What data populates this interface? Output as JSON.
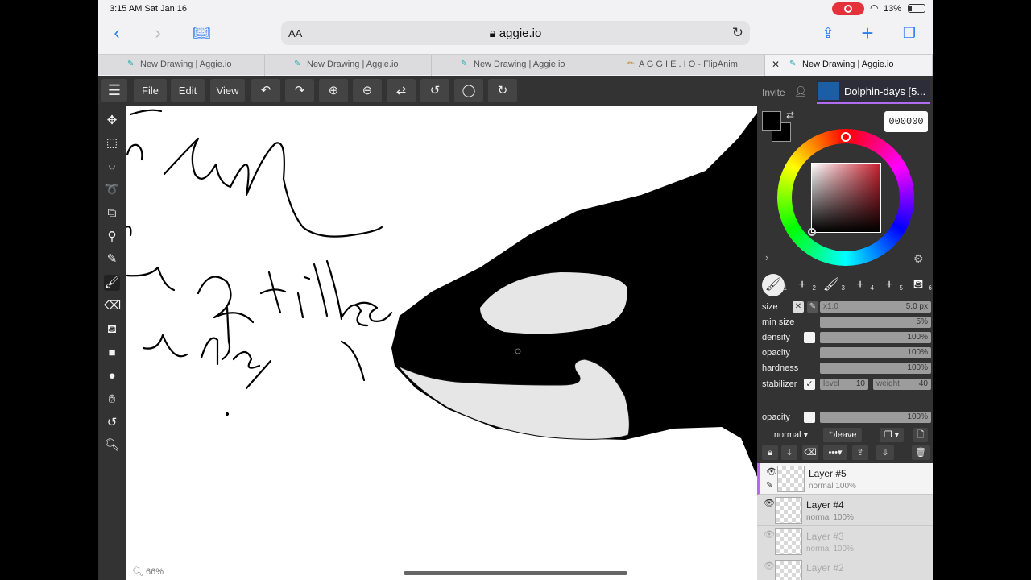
{
  "status": {
    "time": "3:15 AM  Sat Jan 16",
    "battery": "13%"
  },
  "browser": {
    "url": "aggie.io",
    "aa": "AA",
    "tabs": [
      {
        "label": "New Drawing | Aggie.io"
      },
      {
        "label": "New Drawing | Aggie.io"
      },
      {
        "label": "New Drawing | Aggie.io"
      },
      {
        "label": "A G G I E . I O - FlipAnim"
      },
      {
        "label": "New Drawing | Aggie.io"
      }
    ]
  },
  "menu": {
    "file": "File",
    "edit": "Edit",
    "view": "View"
  },
  "canvas": {
    "zoom": "66%"
  },
  "panel": {
    "invite": "Invite",
    "room": "Dolphin-days [5...",
    "hex": "000000",
    "brushes": [
      "1",
      "2",
      "3",
      "4",
      "5",
      "6"
    ],
    "size": {
      "label": "size",
      "mult": "x1.0",
      "value": "5.0 px"
    },
    "min_size": {
      "label": "min size",
      "value": "5%"
    },
    "density": {
      "label": "density",
      "value": "100%"
    },
    "opacity": {
      "label": "opacity",
      "value": "100%"
    },
    "hardness": {
      "label": "hardness",
      "value": "100%"
    },
    "stabilizer": {
      "label": "stabilizer",
      "level_label": "level",
      "level": "10",
      "weight_label": "weight",
      "weight": "40"
    },
    "layer_opacity": {
      "label": "opacity",
      "value": "100%"
    },
    "blend": "normal",
    "leave": "leave",
    "layers": [
      {
        "name": "Layer #5",
        "mode": "normal 100%"
      },
      {
        "name": "Layer #4",
        "mode": "normal 100%"
      },
      {
        "name": "Layer #3",
        "mode": "normal 100%"
      },
      {
        "name": "Layer #2",
        "mode": ""
      }
    ]
  }
}
